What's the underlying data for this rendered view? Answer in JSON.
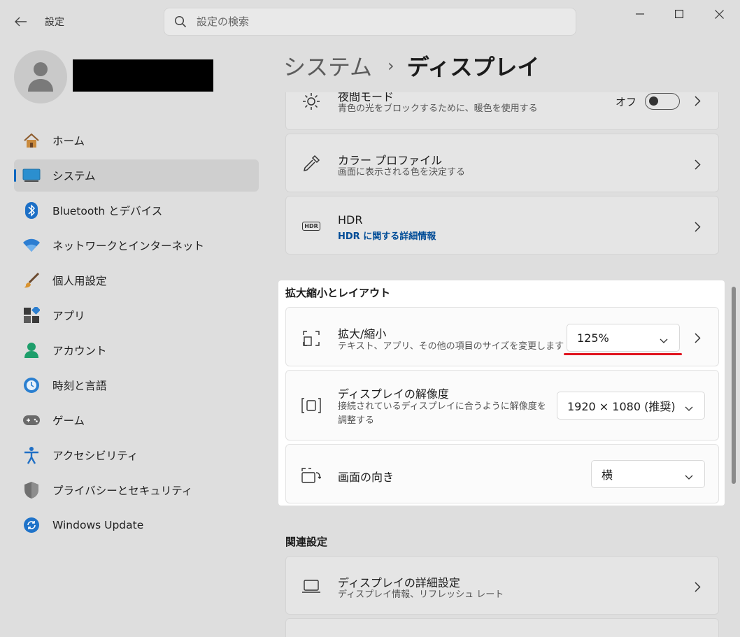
{
  "titlebar": {
    "app_title": "設定",
    "search_placeholder": "設定の検索"
  },
  "sidebar": {
    "items": [
      {
        "label": "ホーム",
        "icon": "home-icon",
        "active": false
      },
      {
        "label": "システム",
        "icon": "monitor-icon",
        "active": true
      },
      {
        "label": "Bluetooth とデバイス",
        "icon": "bluetooth-icon",
        "active": false
      },
      {
        "label": "ネットワークとインターネット",
        "icon": "wifi-icon",
        "active": false
      },
      {
        "label": "個人用設定",
        "icon": "brush-icon",
        "active": false
      },
      {
        "label": "アプリ",
        "icon": "apps-icon",
        "active": false
      },
      {
        "label": "アカウント",
        "icon": "account-icon",
        "active": false
      },
      {
        "label": "時刻と言語",
        "icon": "clock-globe-icon",
        "active": false
      },
      {
        "label": "ゲーム",
        "icon": "gamepad-icon",
        "active": false
      },
      {
        "label": "アクセシビリティ",
        "icon": "accessibility-icon",
        "active": false
      },
      {
        "label": "プライバシーとセキュリティ",
        "icon": "shield-icon",
        "active": false
      },
      {
        "label": "Windows Update",
        "icon": "update-icon",
        "active": false
      }
    ]
  },
  "header": {
    "parent": "システム",
    "separator": "›",
    "current": "ディスプレイ"
  },
  "cards": {
    "night_light": {
      "title": "夜間モード",
      "subtitle": "青色の光をブロックするために、暖色を使用する",
      "toggle_label": "オフ",
      "toggle_on": false
    },
    "color_profile": {
      "title": "カラー プロファイル",
      "subtitle": "画面に表示される色を決定する"
    },
    "hdr": {
      "title": "HDR",
      "link": "HDR に関する詳細情報",
      "icon_text": "HDR"
    }
  },
  "scale_layout": {
    "section_title": "拡大縮小とレイアウト",
    "scale": {
      "title": "拡大/縮小",
      "subtitle": "テキスト、アプリ、その他の項目のサイズを変更します",
      "value": "125%"
    },
    "resolution": {
      "title": "ディスプレイの解像度",
      "subtitle_line1": "接続されているディスプレイに合うように解像度を",
      "subtitle_line2": "調整する",
      "value": "1920 × 1080 (推奨)"
    },
    "orientation": {
      "title": "画面の向き",
      "value": "横"
    }
  },
  "related": {
    "section_title": "関連設定",
    "advanced_display": {
      "title": "ディスプレイの詳細設定",
      "subtitle": "ディスプレイ情報、リフレッシュ レート"
    }
  },
  "colors": {
    "accent": "#0067c0",
    "highlight_underline": "#e0141e"
  }
}
